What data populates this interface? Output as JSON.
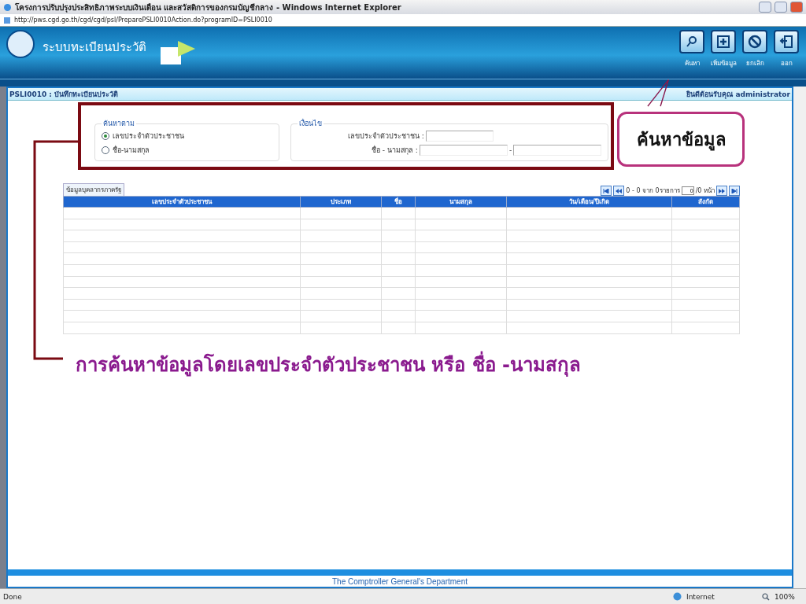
{
  "window": {
    "title": "โครงการปรับปรุงประสิทธิภาพระบบเงินเดือน และสวัสดิการของกรมบัญชีกลาง - Windows Internet Explorer",
    "address": "http://pws.cgd.go.th/cgd/cgd/psl/PreparePSLI0010Action.do?programID=PSLI0010"
  },
  "banner": {
    "title": "ระบบทะเบียนประวัติ"
  },
  "toolbar": [
    {
      "kind": "search",
      "label": "ค้นหา"
    },
    {
      "kind": "add",
      "label": "เพิ่มข้อมูล"
    },
    {
      "kind": "cancel",
      "label": "ยกเลิก"
    },
    {
      "kind": "exit",
      "label": "ออก"
    }
  ],
  "page_header": {
    "title": "PSLI0010 : บันทึกทะเบียนประวัติ",
    "welcome": "ยินดีต้อนรับคุณ administrator"
  },
  "search_by": {
    "legend": "ค้นหาตาม",
    "options": [
      {
        "label": "เลขประจำตัวประชาชน",
        "selected": true
      },
      {
        "label": "ชื่อ-นามสกุล",
        "selected": false
      }
    ]
  },
  "conditions": {
    "legend": "เงื่อนไข",
    "rows": [
      {
        "label": "เลขประจำตัวประชาชน :",
        "kind": "single"
      },
      {
        "label": "ชื่อ - นามสกุล :",
        "kind": "pair",
        "separator": "-"
      }
    ]
  },
  "table": {
    "tab": "ข้อมูลบุคลากรภาครัฐ",
    "pager": {
      "range": "0 - 0 จาก 0รายการ",
      "page": "0",
      "pages": "/0 หน้า"
    },
    "columns": [
      "เลขประจำตัวประชาชน",
      "ประเภท",
      "ชื่อ",
      "นามสกุล",
      "วัน/เดือน/ปีเกิด",
      "สังกัด"
    ]
  },
  "footer": "The Comptroller General's Department",
  "status_bar": {
    "left": "Done",
    "zone": "Internet",
    "zoom": "100%"
  },
  "annotations": {
    "callout": "ค้นหาข้อมูล",
    "caption": "การค้นหาข้อมูลโดยเลขประจำตัวประชาชน หรือ ชื่อ -นามสกุล"
  }
}
